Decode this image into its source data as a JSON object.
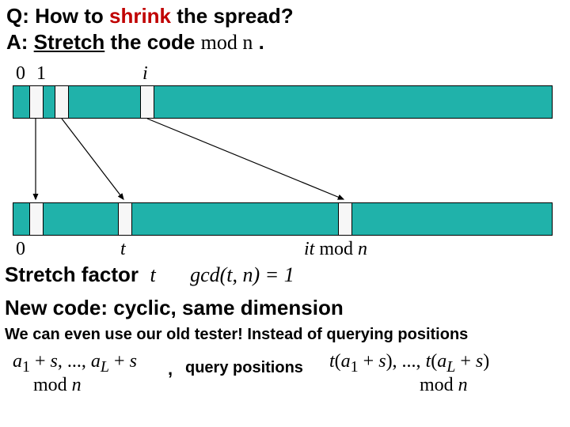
{
  "qa": {
    "q_prefix": "Q: How to ",
    "shrink": "shrink",
    "q_suffix": " the spread?",
    "a_prefix": "A:  ",
    "stretch": "Stretch",
    "a_mid": " the code ",
    "modn": "mod n",
    "a_end": " ."
  },
  "top_labels": {
    "zero": "0",
    "one": "1",
    "i": "i"
  },
  "bot_labels": {
    "zero": "0",
    "t": "t",
    "itmodn": "it mod n"
  },
  "stretch_line": {
    "label": "Stretch factor",
    "t": "t",
    "gcd": "gcd(t, n) = 1"
  },
  "newcode": "New code: cyclic, same dimension",
  "tester": "We can even use our old tester! Instead of querying positions",
  "bottom": {
    "expr1_a": "a",
    "expr1_sub1": "1",
    "expr1_mid": " + s, ..., a",
    "expr1_subL": "L",
    "expr1_end": " + s",
    "modn1": "mod n",
    "comma": ",",
    "query": "query positions",
    "expr2_t1": "t",
    "expr2_p1": "(a",
    "expr2_sub1": "1",
    "expr2_mid": " + s), ..., t(a",
    "expr2_subL": "L",
    "expr2_end": " + s)",
    "modn2": "mod n"
  }
}
